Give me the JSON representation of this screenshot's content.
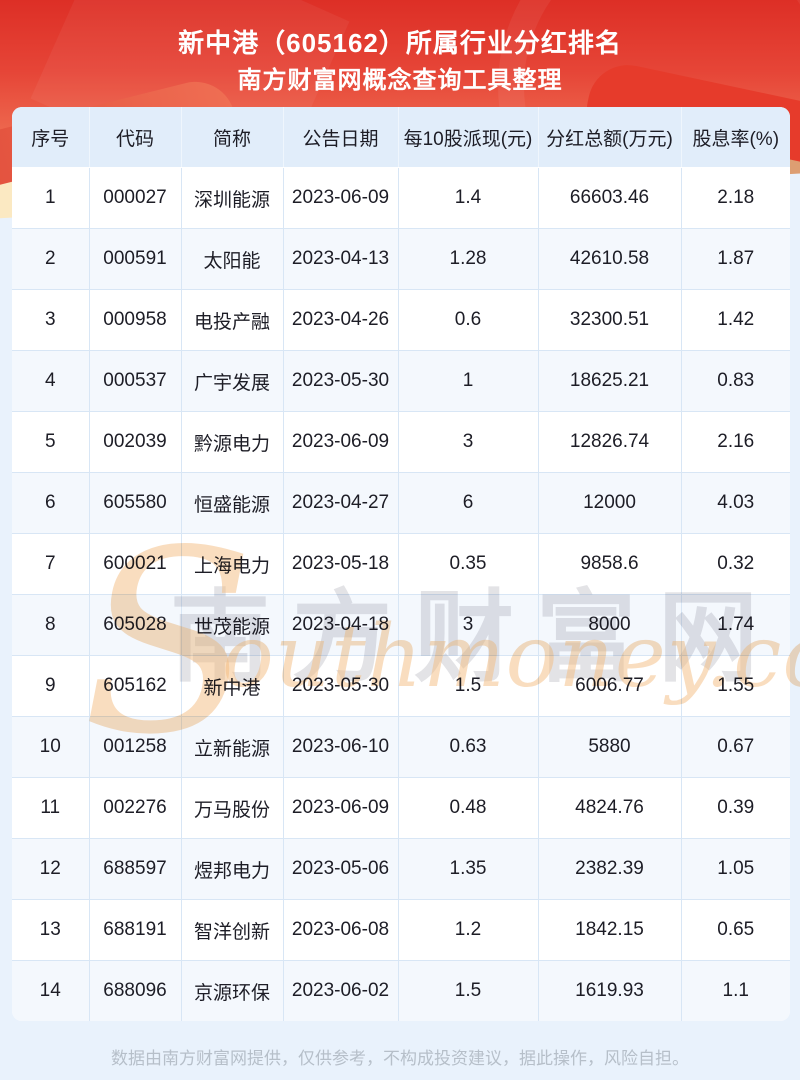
{
  "banner": {
    "title_line1": "新中港（605162）所属行业分红排名",
    "title_line2": "南方财富网概念查询工具整理"
  },
  "chart_data": {
    "type": "table",
    "title": "新中港（605162）所属行业分红排名 - 南方财富网概念查询工具整理",
    "columns": [
      "序号",
      "代码",
      "简称",
      "公告日期",
      "每10股派现(元)",
      "分红总额(万元)",
      "股息率(%)"
    ],
    "rows": [
      [
        "1",
        "000027",
        "深圳能源",
        "2023-06-09",
        "1.4",
        "66603.46",
        "2.18"
      ],
      [
        "2",
        "000591",
        "太阳能",
        "2023-04-13",
        "1.28",
        "42610.58",
        "1.87"
      ],
      [
        "3",
        "000958",
        "电投产融",
        "2023-04-26",
        "0.6",
        "32300.51",
        "1.42"
      ],
      [
        "4",
        "000537",
        "广宇发展",
        "2023-05-30",
        "1",
        "18625.21",
        "0.83"
      ],
      [
        "5",
        "002039",
        "黔源电力",
        "2023-06-09",
        "3",
        "12826.74",
        "2.16"
      ],
      [
        "6",
        "605580",
        "恒盛能源",
        "2023-04-27",
        "6",
        "12000",
        "4.03"
      ],
      [
        "7",
        "600021",
        "上海电力",
        "2023-05-18",
        "0.35",
        "9858.6",
        "0.32"
      ],
      [
        "8",
        "605028",
        "世茂能源",
        "2023-04-18",
        "3",
        "8000",
        "1.74"
      ],
      [
        "9",
        "605162",
        "新中港",
        "2023-05-30",
        "1.5",
        "6006.77",
        "1.55"
      ],
      [
        "10",
        "001258",
        "立新能源",
        "2023-06-10",
        "0.63",
        "5880",
        "0.67"
      ],
      [
        "11",
        "002276",
        "万马股份",
        "2023-06-09",
        "0.48",
        "4824.76",
        "0.39"
      ],
      [
        "12",
        "688597",
        "煜邦电力",
        "2023-05-06",
        "1.35",
        "2382.39",
        "1.05"
      ],
      [
        "13",
        "688191",
        "智洋创新",
        "2023-06-08",
        "1.2",
        "1842.15",
        "0.65"
      ],
      [
        "14",
        "688096",
        "京源环保",
        "2023-06-02",
        "1.5",
        "1619.93",
        "1.1"
      ]
    ]
  },
  "watermark": {
    "cn": "南方财富网",
    "s": "S",
    "en": "outhmoney.com"
  },
  "footer": {
    "disclaimer": "数据由南方财富网提供，仅供参考，不构成投资建议，据此操作，风险自担。"
  },
  "colors": {
    "banner_red_top": "#dd2f26",
    "banner_red_bottom": "#f8c5ae",
    "header_bg": "#e1edfa",
    "row_alt_bg": "#f4f8fd",
    "cell_border": "#d8e6f5",
    "page_bg": "#e9f2fc",
    "text": "#1d1d26",
    "footer_text": "#b6bfc9",
    "watermark_orange": "#f3bc80",
    "watermark_gray": "#b9b9c0",
    "decor_cream": "#fbe9c2",
    "decor_orange": "#dd9e72"
  }
}
